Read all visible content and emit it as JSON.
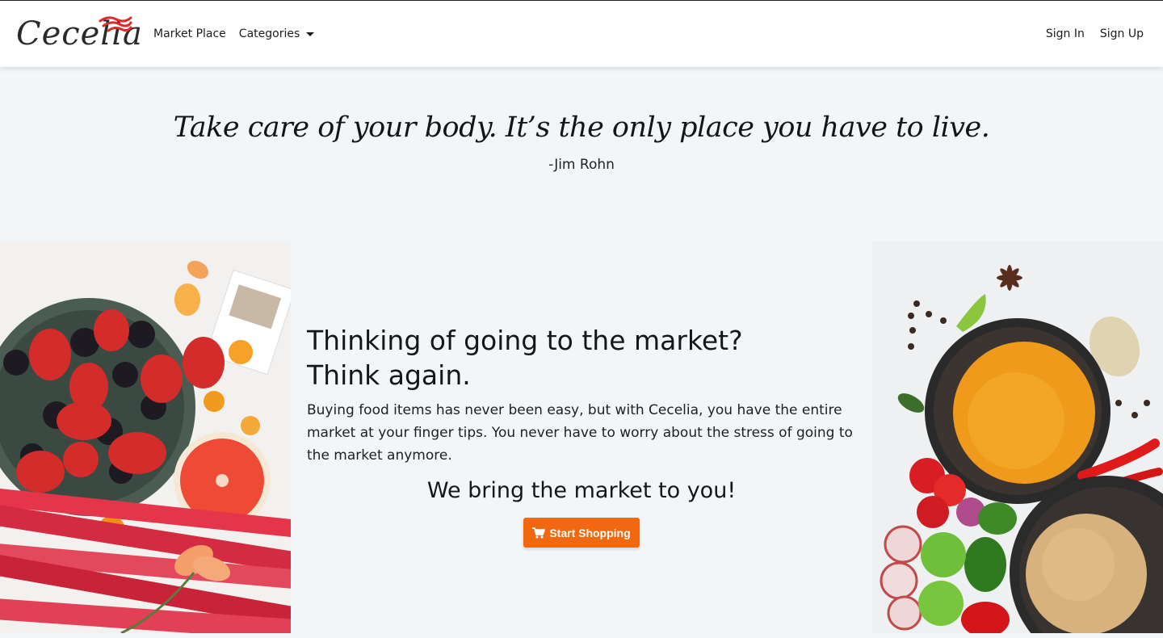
{
  "brand": {
    "name": "Cecelia"
  },
  "nav": {
    "marketplace": "Market Place",
    "categories": "Categories",
    "sign_in": "Sign In",
    "sign_up": "Sign Up"
  },
  "quote": {
    "text": "Take care of your body. It’s the only place you have to live.",
    "author": "-Jim Rohn"
  },
  "hero": {
    "title_line1": "Thinking of going to the market?",
    "title_line2": "Think again.",
    "body": "Buying food items has never been easy, but with Cecelia, you have the entire market at your finger tips. You never have to worry about the stress of going to the market anymore.",
    "tagline": "We bring the market to you!",
    "cta_label": "Start Shopping"
  },
  "colors": {
    "accent": "#f0680f",
    "background": "#f3f6f9",
    "brand_wave": "#e02b2b"
  },
  "icons": {
    "cart": "shopping-cart-icon",
    "dropdown": "caret-down-icon"
  }
}
